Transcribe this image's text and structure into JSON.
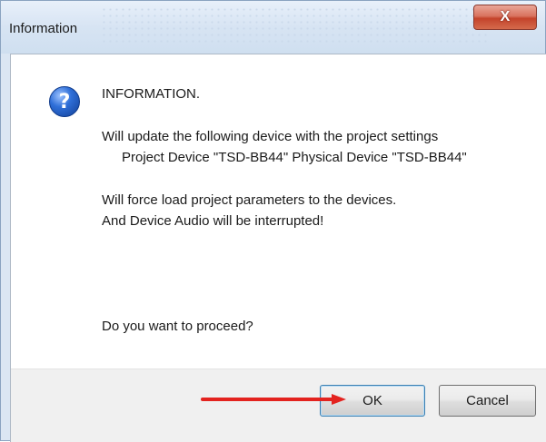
{
  "window": {
    "title": "Information",
    "close_label": "X"
  },
  "message": {
    "icon": "question-icon",
    "heading": "INFORMATION.",
    "line1": "Will update the following device with the project settings",
    "line2": "Project Device \"TSD-BB44\" Physical Device \"TSD-BB44\"",
    "line3": "Will force load project parameters to the devices.",
    "line4": "And Device Audio will be interrupted!",
    "question": "Do you want to proceed?"
  },
  "buttons": {
    "ok_label": "OK",
    "cancel_label": "Cancel"
  },
  "annotation": {
    "arrow_color": "#e3231f"
  }
}
